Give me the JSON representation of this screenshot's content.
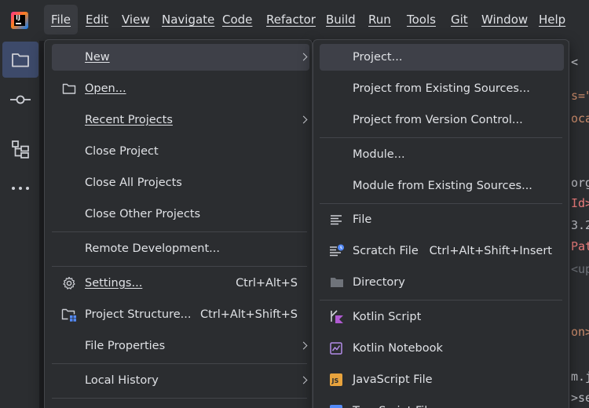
{
  "menubar": {
    "items": [
      {
        "label": "File",
        "active": true
      },
      {
        "label": "Edit"
      },
      {
        "label": "View"
      },
      {
        "label": "Navigate"
      },
      {
        "label": "Code"
      },
      {
        "label": "Refactor"
      },
      {
        "label": "Build"
      },
      {
        "label": "Run"
      },
      {
        "label": "Tools"
      },
      {
        "label": "Git"
      },
      {
        "label": "Window"
      },
      {
        "label": "Help"
      }
    ]
  },
  "toolstrip": {
    "icons": [
      "folder-icon",
      "commit-icon",
      "structure-icon",
      "more-icon"
    ]
  },
  "file_menu": {
    "items": [
      {
        "label": "New",
        "has_submenu": true,
        "highlighted": true
      },
      {
        "label": "Open...",
        "icon": "folder-icon"
      },
      {
        "label": "Recent Projects",
        "has_submenu": true
      },
      {
        "label": "Close Project"
      },
      {
        "label": "Close All Projects"
      },
      {
        "label": "Close Other Projects"
      },
      {
        "label": "Remote Development..."
      },
      {
        "label": "Settings...",
        "icon": "gear-icon",
        "shortcut": "Ctrl+Alt+S"
      },
      {
        "label": "Project Structure...",
        "icon": "project-structure-icon",
        "shortcut": "Ctrl+Alt+Shift+S"
      },
      {
        "label": "File Properties",
        "has_submenu": true
      },
      {
        "label": "Local History",
        "has_submenu": true
      }
    ]
  },
  "new_submenu": {
    "items": [
      {
        "label": "Project...",
        "highlighted": true
      },
      {
        "label": "Project from Existing Sources..."
      },
      {
        "label": "Project from Version Control..."
      },
      {
        "label": "Module..."
      },
      {
        "label": "Module from Existing Sources..."
      },
      {
        "label": "File",
        "icon": "file-icon"
      },
      {
        "label": "Scratch File",
        "icon": "scratch-file-icon",
        "shortcut": "Ctrl+Alt+Shift+Insert"
      },
      {
        "label": "Directory",
        "icon": "directory-icon"
      },
      {
        "label": "Kotlin Script",
        "icon": "kotlin-script-icon"
      },
      {
        "label": "Kotlin Notebook",
        "icon": "kotlin-notebook-icon"
      },
      {
        "label": "JavaScript File",
        "icon": "javascript-icon"
      },
      {
        "label": "TypeScript File",
        "icon": "typescript-icon"
      }
    ]
  },
  "editor_fragments": [
    "<",
    "s=\"",
    "oca",
    "org",
    "Id>",
    "3.2",
    "Pat",
    "<up",
    "on>",
    "m.j",
    ">se"
  ],
  "colors": {
    "background": "#1e1f22",
    "panel": "#2b2d30",
    "highlight": "#3e4048",
    "selected_tool": "#3d4a6a",
    "text": "#dfe1e5",
    "code_orange": "#cf8e6d",
    "code_red": "#ef7e7e",
    "code_purple": "#c77dbb"
  }
}
